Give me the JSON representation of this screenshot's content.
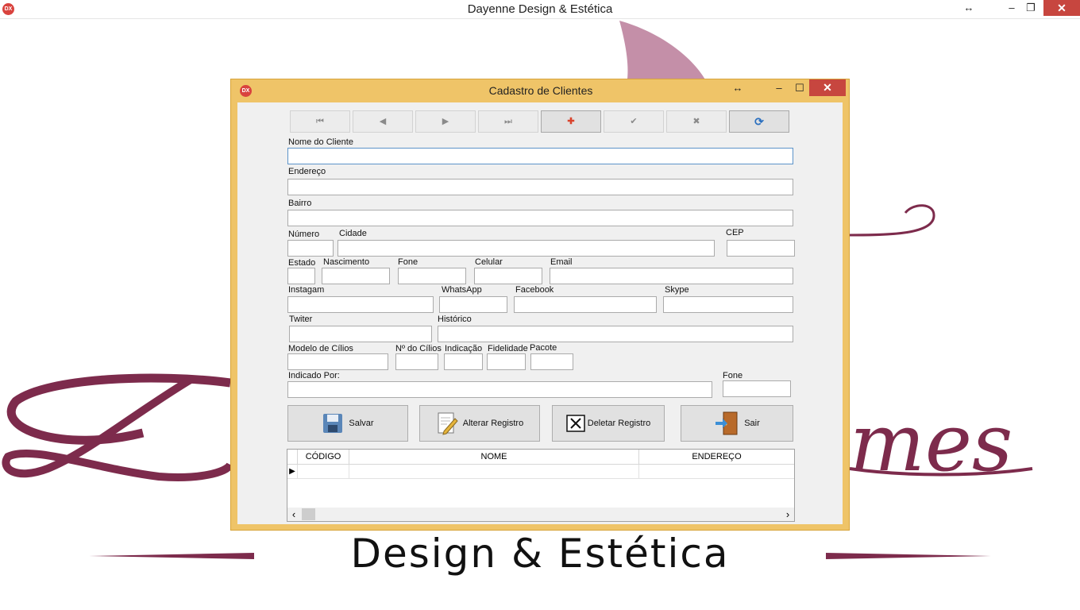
{
  "main_window": {
    "title": "Dayenne Design & Estética",
    "icon_text": "DX",
    "controls": {
      "resize": "↔",
      "minimize": "–",
      "restore": "❐",
      "close": "✕"
    }
  },
  "background": {
    "tagline": "Design & Estética",
    "script_text": "mes",
    "colors": {
      "burgundy": "#7d2b4c",
      "mauve": "#c48fa8"
    }
  },
  "dialog": {
    "title": "Cadastro de Clientes",
    "icon_text": "DX",
    "controls": {
      "resize": "↔",
      "minimize": "–",
      "maximize": "☐",
      "close": "✕"
    },
    "navigator": [
      "⏮",
      "◀",
      "▶",
      "⏭",
      "✚",
      "✔",
      "✖",
      "⟳"
    ],
    "fields": {
      "nome": {
        "label": "Nome do Cliente",
        "value": ""
      },
      "endereco": {
        "label": "Endereço",
        "value": ""
      },
      "bairro": {
        "label": "Bairro",
        "value": ""
      },
      "numero": {
        "label": "Número",
        "value": ""
      },
      "cidade": {
        "label": "Cidade",
        "value": ""
      },
      "cep": {
        "label": "CEP",
        "value": ""
      },
      "estado": {
        "label": "Estado",
        "value": ""
      },
      "nascimento": {
        "label": "Nascimento",
        "value": ""
      },
      "fone": {
        "label": "Fone",
        "value": ""
      },
      "celular": {
        "label": "Celular",
        "value": ""
      },
      "email": {
        "label": "Email",
        "value": ""
      },
      "instagram": {
        "label": "Instagam",
        "value": ""
      },
      "whatsapp": {
        "label": "WhatsApp",
        "value": ""
      },
      "facebook": {
        "label": "Facebook",
        "value": ""
      },
      "skype": {
        "label": "Skype",
        "value": ""
      },
      "twitter": {
        "label": "Twiter",
        "value": ""
      },
      "historico": {
        "label": "Histórico",
        "value": ""
      },
      "modelo_cilios": {
        "label": "Modelo de Cílios",
        "value": ""
      },
      "n_cilios": {
        "label": "Nº do Cílios",
        "value": ""
      },
      "indicacao": {
        "label": "Indicação",
        "value": ""
      },
      "fidelidade": {
        "label": "Fidelidade",
        "value": ""
      },
      "pacote": {
        "label": "Pacote",
        "value": ""
      },
      "indicado_por": {
        "label": "Indicado Por:",
        "value": ""
      },
      "fone_indicado": {
        "label": "Fone",
        "value": ""
      }
    },
    "buttons": {
      "salvar": "Salvar",
      "alterar": "Alterar Registro",
      "deletar": "Deletar Registro",
      "sair": "Sair"
    },
    "grid": {
      "columns": [
        "CÓDIGO",
        "NOME",
        "ENDEREÇO"
      ],
      "row_indicator": "▶",
      "scroll_left": "‹",
      "scroll_right": "›"
    }
  }
}
